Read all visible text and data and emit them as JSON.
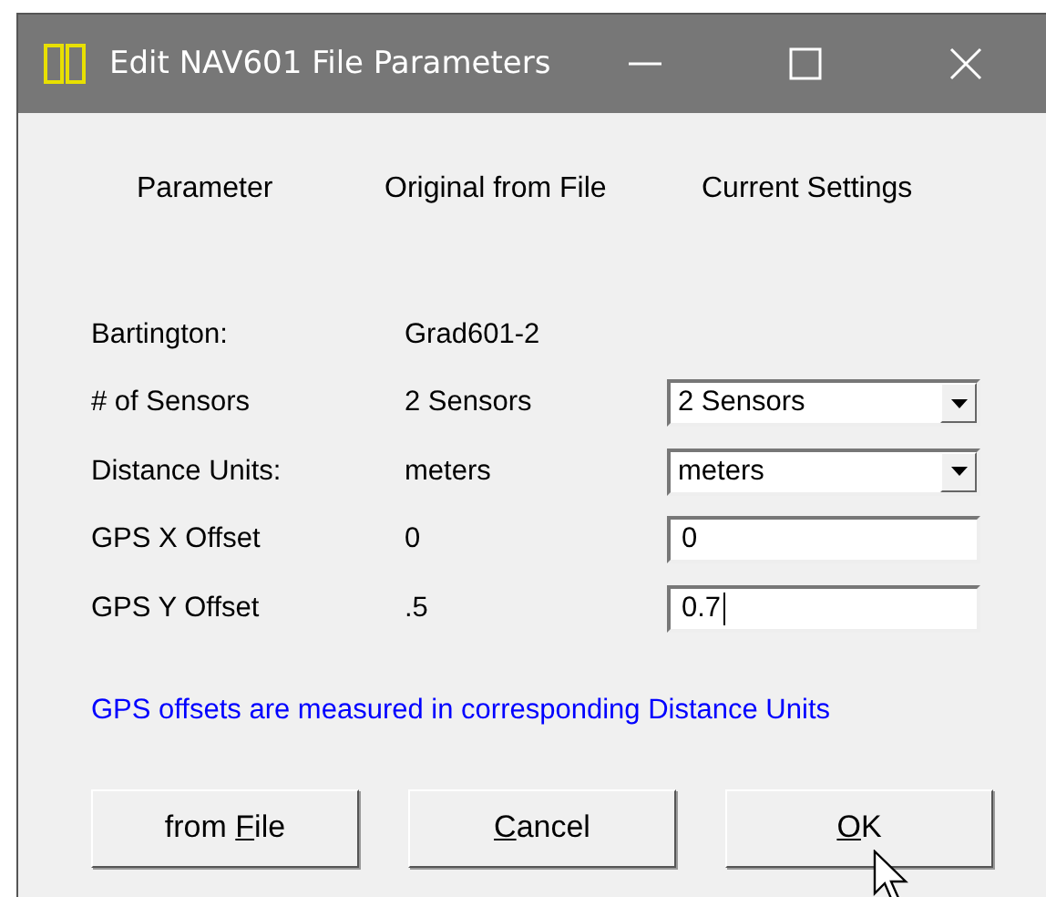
{
  "window": {
    "title": "Edit NAV601 File Parameters"
  },
  "columns": [
    "Parameter",
    "Original from File",
    "Current Settings"
  ],
  "rows": [
    {
      "label": "Bartington:",
      "original": "Grad601-2"
    },
    {
      "label": "# of Sensors",
      "original": "2 Sensors",
      "current": {
        "kind": "dropdown",
        "value": "2 Sensors"
      }
    },
    {
      "label": "Distance Units:",
      "original": "meters",
      "current": {
        "kind": "dropdown",
        "value": "meters"
      }
    },
    {
      "label": "GPS X Offset",
      "original": "0",
      "current": {
        "kind": "text",
        "value": "0",
        "focused": false
      }
    },
    {
      "label": "GPS Y Offset",
      "original": ".5",
      "current": {
        "kind": "text",
        "value": "0.7",
        "focused": true
      }
    }
  ],
  "note": "GPS offsets are measured in corresponding Distance Units",
  "buttons": [
    {
      "before_key": "from ",
      "access_key": "F",
      "after_key": "ile"
    },
    {
      "access_key": "C",
      "after_key": "ancel"
    },
    {
      "access_key": "O",
      "after_key": "K"
    }
  ]
}
